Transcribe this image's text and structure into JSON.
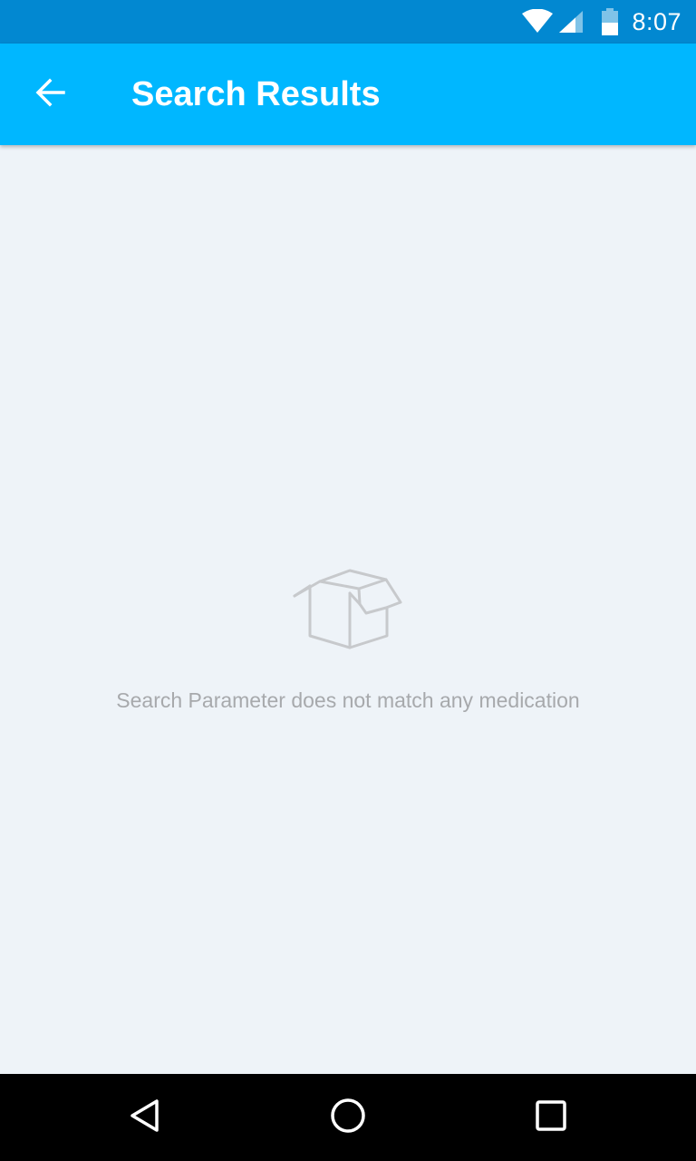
{
  "status_bar": {
    "time": "8:07",
    "icons": [
      "wifi-icon",
      "cellular-signal-icon",
      "battery-icon"
    ]
  },
  "app_bar": {
    "back_icon": "arrow-back-icon",
    "title": "Search Results"
  },
  "empty_state": {
    "icon": "open-box-icon",
    "message": "Search Parameter does not match any medication"
  },
  "nav_bar": {
    "icons": [
      "nav-back-icon",
      "nav-home-icon",
      "nav-recents-icon"
    ]
  },
  "colors": {
    "status_bar": "#0288d1",
    "app_bar": "#00b7ff",
    "background": "#eef3f8",
    "empty_text": "#a7a9ac",
    "icon_gray": "#c7c9cc"
  }
}
